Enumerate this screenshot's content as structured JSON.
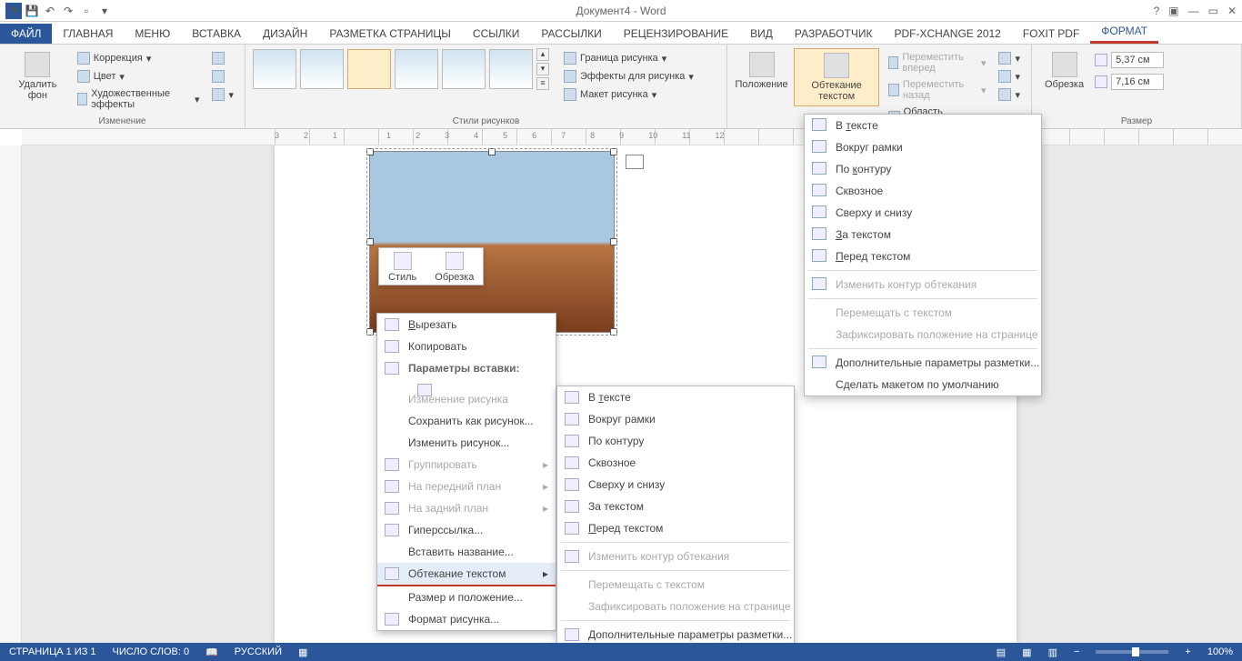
{
  "title": "Документ4 - Word",
  "tabs": {
    "file": "ФАЙЛ",
    "home": "ГЛАВНАЯ",
    "menu": "Меню",
    "insert": "ВСТАВКА",
    "design": "ДИЗАЙН",
    "layout": "РАЗМЕТКА СТРАНИЦЫ",
    "refs": "ССЫЛКИ",
    "mailings": "РАССЫЛКИ",
    "review": "РЕЦЕНЗИРОВАНИЕ",
    "view": "ВИД",
    "dev": "РАЗРАБОТЧИК",
    "pdfx": "PDF-XCHANGE 2012",
    "foxit": "Foxit PDF",
    "format": "ФОРМАТ"
  },
  "ribbon": {
    "adjust": {
      "removeBg": "Удалить фон",
      "corrections": "Коррекция",
      "color": "Цвет",
      "effects": "Художественные эффекты",
      "label": "Изменение"
    },
    "styles": {
      "label": "Стили рисунков"
    },
    "border": {
      "border": "Граница рисунка",
      "effects": "Эффекты для рисунка",
      "layout": "Макет рисунка"
    },
    "arrange": {
      "position": "Положение",
      "wrap": "Обтекание текстом",
      "fwd": "Переместить вперед",
      "back": "Переместить назад",
      "selection": "Область выделения"
    },
    "crop": {
      "crop": "Обрезка",
      "label": "Размер"
    },
    "size": {
      "h": "5,37 см",
      "w": "7,16 см"
    }
  },
  "ruler": [
    "3",
    "2",
    "1",
    "1",
    "2",
    "3",
    "4",
    "5",
    "6",
    "7",
    "8",
    "9",
    "10",
    "11",
    "12"
  ],
  "miniToolbar": {
    "style": "Стиль",
    "crop": "Обрезка"
  },
  "ctx": {
    "cut": "Вырезать",
    "copy": "Копировать",
    "pasteOptHdr": "Параметры вставки:",
    "changePic": "Изменение рисунка",
    "saveAs": "Сохранить как рисунок...",
    "editPic": "Изменить рисунок...",
    "group": "Группировать",
    "front": "На передний план",
    "back": "На задний план",
    "link": "Гиперссылка...",
    "caption": "Вставить название...",
    "wrap": "Обтекание текстом",
    "sizePos": "Размер и положение...",
    "fmt": "Формат рисунка..."
  },
  "wrapMenu": {
    "inline": "В тексте",
    "square": "Вокруг рамки",
    "tight": "По контуру",
    "through": "Сквозное",
    "topBottom": "Сверху и снизу",
    "behind": "За текстом",
    "front": "Перед текстом",
    "editPoints": "Изменить контур обтекания",
    "moveWith": "Перемещать с текстом",
    "fix": "Зафиксировать положение на странице",
    "more": "Дополнительные параметры разметки...",
    "default": "Сделать макетом по умолчанию"
  },
  "status": {
    "page": "СТРАНИЦА 1 ИЗ 1",
    "words": "ЧИСЛО СЛОВ: 0",
    "lang": "РУССКИЙ",
    "zoom": "100%"
  }
}
